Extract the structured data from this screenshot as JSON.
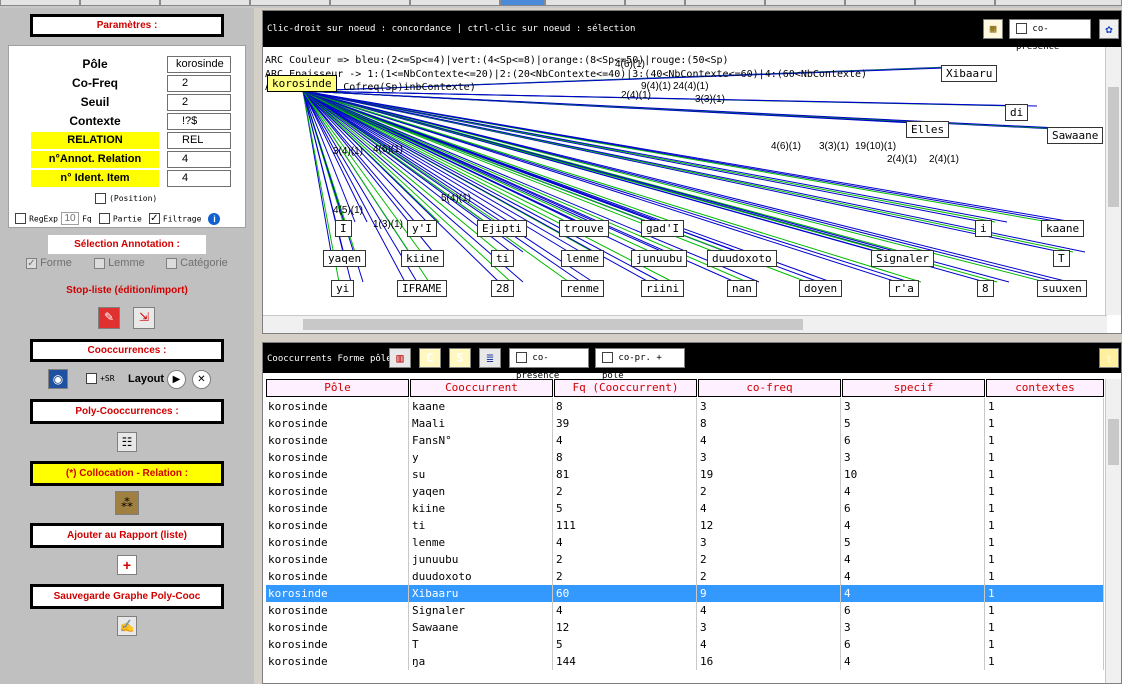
{
  "params": {
    "title": "Paramètres :",
    "pole_label": "Pôle",
    "pole_value": "korosinde",
    "cofreq_label": "Co-Freq",
    "cofreq_value": "2",
    "seuil_label": "Seuil",
    "seuil_value": "2",
    "contexte_label": "Contexte",
    "contexte_value": "!?$",
    "relation_label": "RELATION",
    "relation_value": "REL",
    "annot_label": "n°Annot. Relation",
    "annot_value": "4",
    "ident_label": "n° Ident. Item",
    "ident_value": "4",
    "position_label": "(Position)",
    "regexp_label": "RegExp",
    "fq_value": "10",
    "fq_label": "Fq",
    "partie_label": "Partie",
    "filtrage_label": "Filtrage",
    "filtrage_check": "✓"
  },
  "annotation": {
    "title": "Sélection Annotation :",
    "forme_label": "Forme",
    "forme_check": "✓",
    "lemme_label": "Lemme",
    "categorie_label": "Catégorie"
  },
  "stoplist_title": "Stop-liste (édition/import)",
  "cooc": {
    "title": "Cooccurrences :",
    "sr_label": "+SR",
    "layout_label": "Layout"
  },
  "polycooc_title": "Poly-Cooccurrences :",
  "collocation_title": "(*) Collocation - Relation :",
  "rapport_title": "Ajouter au Rapport (liste)",
  "sauvegarde_title": "Sauvegarde Graphe Poly-Cooc",
  "graph": {
    "hint": "Clic-droit sur noeud : concordance | ctrl-clic sur noeud : sélection",
    "copresence_label": "co-présence",
    "legend_color": "ARC Couleur => bleu:(2<=Sp<=4)|vert:(4<Sp<=8)|orange:(8<Sp<=50)|rouge:(50<Sp)",
    "legend_thickness": "ARC Epaisseur -> 1:(1<=NbContexte<=20)|2:(20<NbContexte<=40)|3:(40<NbContexte<=60)|4:(60<NbContexte)",
    "legend_label": "ARC label => Cofreq(Sp)inbContexte)",
    "center": "korosinde",
    "nodes": [
      "Xibaaru",
      "di",
      "Elles",
      "Sawaane",
      "I",
      "y'I",
      "Ejipti",
      "trouve",
      "gad'I",
      "i",
      "kaane",
      "yaqen",
      "kiine",
      "ti",
      "lenme",
      "junuubu",
      "duudoxoto",
      "Signaler",
      "T",
      "yi",
      "IFRAME",
      "28",
      "renme",
      "riini",
      "nan",
      "doyen",
      "r'a",
      "8",
      "suuxen"
    ],
    "labels": [
      "4(6)(1)",
      "9(4)(1)",
      "24(4)(1)",
      "2(4)(1)",
      "3(3)(1)",
      "19(10)(1)",
      "3(3)(1)",
      "4(6)(1)",
      "2(4)(1)",
      "2(4)(1)",
      "3(4)(1)",
      "4(6)(1)",
      "1(3)(1)",
      "4(5)(1)",
      "5(4)(1)"
    ]
  },
  "table": {
    "toolbar_label": "Cooccurrents Forme pôle",
    "copresence_label": "co-présence",
    "copr_pole_label": "co-pr. + pôle",
    "headers": [
      "Pôle",
      "Cooccurrent",
      "Fq (Cooccurrent)",
      "co-freq",
      "specif",
      "contextes"
    ],
    "rows": [
      [
        "korosinde",
        "kaane",
        "8",
        "3",
        "3",
        "1"
      ],
      [
        "korosinde",
        "Maali",
        "39",
        "8",
        "5",
        "1"
      ],
      [
        "korosinde",
        "FansN°",
        "4",
        "4",
        "6",
        "1"
      ],
      [
        "korosinde",
        "y",
        "8",
        "3",
        "3",
        "1"
      ],
      [
        "korosinde",
        "su",
        "81",
        "19",
        "10",
        "1"
      ],
      [
        "korosinde",
        "yaqen",
        "2",
        "2",
        "4",
        "1"
      ],
      [
        "korosinde",
        "kiine",
        "5",
        "4",
        "6",
        "1"
      ],
      [
        "korosinde",
        "ti",
        "111",
        "12",
        "4",
        "1"
      ],
      [
        "korosinde",
        "lenme",
        "4",
        "3",
        "5",
        "1"
      ],
      [
        "korosinde",
        "junuubu",
        "2",
        "2",
        "4",
        "1"
      ],
      [
        "korosinde",
        "duudoxoto",
        "2",
        "2",
        "4",
        "1"
      ],
      [
        "korosinde",
        "Xibaaru",
        "60",
        "9",
        "4",
        "1"
      ],
      [
        "korosinde",
        "Signaler",
        "4",
        "4",
        "6",
        "1"
      ],
      [
        "korosinde",
        "Sawaane",
        "12",
        "3",
        "3",
        "1"
      ],
      [
        "korosinde",
        "T",
        "5",
        "4",
        "6",
        "1"
      ],
      [
        "korosinde",
        "ŋa",
        "144",
        "16",
        "4",
        "1"
      ]
    ],
    "selected_row": "Xibaaru"
  },
  "icons": [
    "search-icon",
    "edit-icon",
    "import-icon",
    "disc-icon",
    "play-icon",
    "stop-icon",
    "tree-icon",
    "network-icon",
    "plus-icon",
    "save-icon",
    "info-icon",
    "grid-icon",
    "color-icon",
    "export-icon"
  ],
  "colors": {
    "red_title": "#d00000",
    "yellow": "#ffff00",
    "selection": "#3399ff",
    "arc_blue": "#0000cc",
    "arc_green": "#00bb00"
  }
}
